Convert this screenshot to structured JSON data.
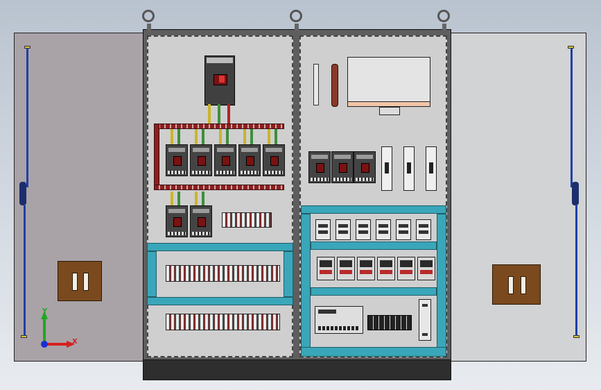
{
  "axes": {
    "x_label": "X",
    "y_label": "Y",
    "x_color": "#d42020",
    "y_color": "#1fa81f",
    "z_color": "#1a2fd0"
  },
  "colors": {
    "busbar": "#8b2020",
    "duct": "#3aa6b9",
    "door_rod": "#1f3fa8",
    "handle": "#7a4a1e"
  },
  "components": {
    "main_breaker": "main-circuit-breaker",
    "branch_breakers_top_row": 5,
    "branch_breakers_second_row": 2,
    "right_breakers": 3,
    "fuse_holders": 3,
    "relay_modules_row1": 6,
    "relay_modules_row2": 6
  }
}
